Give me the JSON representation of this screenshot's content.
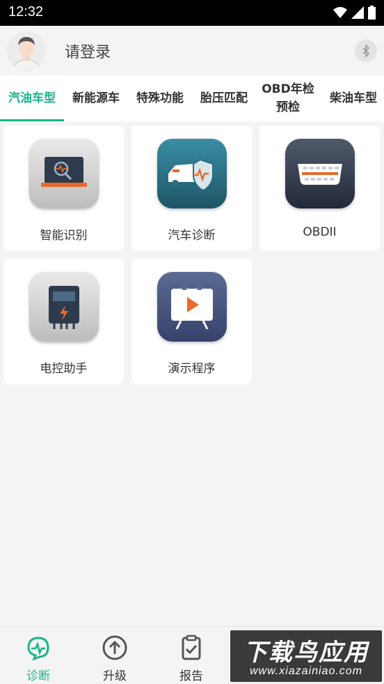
{
  "status_bar": {
    "time": "12:32"
  },
  "header": {
    "login_text": "请登录"
  },
  "tabs": [
    {
      "label": "汽油车型"
    },
    {
      "label": "新能源车"
    },
    {
      "label": "特殊功能"
    },
    {
      "label": "胎压匹配"
    },
    {
      "label": "OBD年检预检"
    },
    {
      "label": "柴油车型"
    }
  ],
  "apps": [
    {
      "label": "智能识别",
      "icon": "smart-identify-icon"
    },
    {
      "label": "汽车诊断",
      "icon": "car-diagnosis-icon"
    },
    {
      "label": "OBDII",
      "icon": "obd-connector-icon"
    },
    {
      "label": "电控助手",
      "icon": "ecu-assistant-icon"
    },
    {
      "label": "演示程序",
      "icon": "demo-program-icon"
    }
  ],
  "bottom_nav": [
    {
      "label": "诊断",
      "icon": "diagnosis-icon"
    },
    {
      "label": "升级",
      "icon": "upgrade-icon"
    },
    {
      "label": "报告",
      "icon": "report-icon"
    }
  ],
  "watermark": {
    "title": "下载鸟应用",
    "url": "www.xiazainiao.com"
  },
  "colors": {
    "accent": "#17b58a",
    "background": "#f4f4f4"
  }
}
